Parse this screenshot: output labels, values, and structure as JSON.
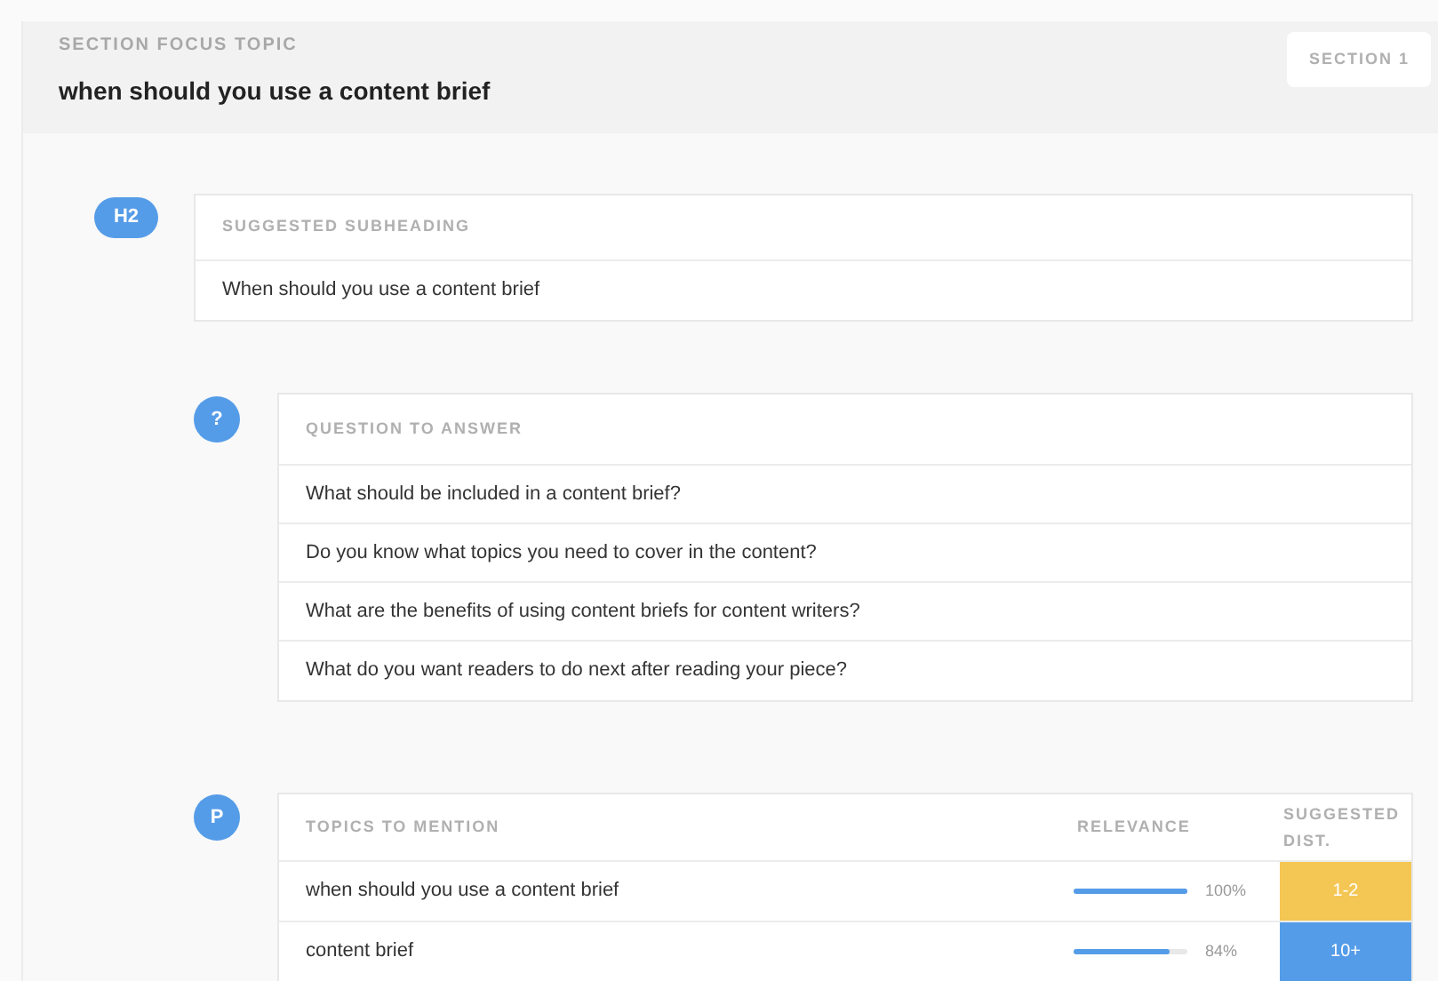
{
  "header": {
    "label": "SECTION FOCUS TOPIC",
    "topic": "when should you use a content brief",
    "section_badge": "SECTION 1"
  },
  "subheading": {
    "badge": "H2",
    "label": "SUGGESTED SUBHEADING",
    "text": "When should you use a content brief"
  },
  "questions": {
    "badge": "?",
    "label": "QUESTION TO ANSWER",
    "items": [
      "What should be included in a content brief?",
      "Do you know what topics you need to cover in the content?",
      "What are the benefits of using content briefs for content writers?",
      "What do you want readers to do next after reading your piece?"
    ]
  },
  "topics": {
    "badge": "P",
    "columns": [
      "TOPICS TO MENTION",
      "RELEVANCE",
      "SUGGESTED DIST."
    ],
    "rows": [
      {
        "topic": "when should you use a content brief",
        "level": 1,
        "reading": "100%",
        "dist": "1-2",
        "color": "#f4c653"
      },
      {
        "topic": "content brief",
        "level": 0.84,
        "reading": "84%",
        "dist": "10+",
        "color": "#559ce8"
      }
    ]
  }
}
